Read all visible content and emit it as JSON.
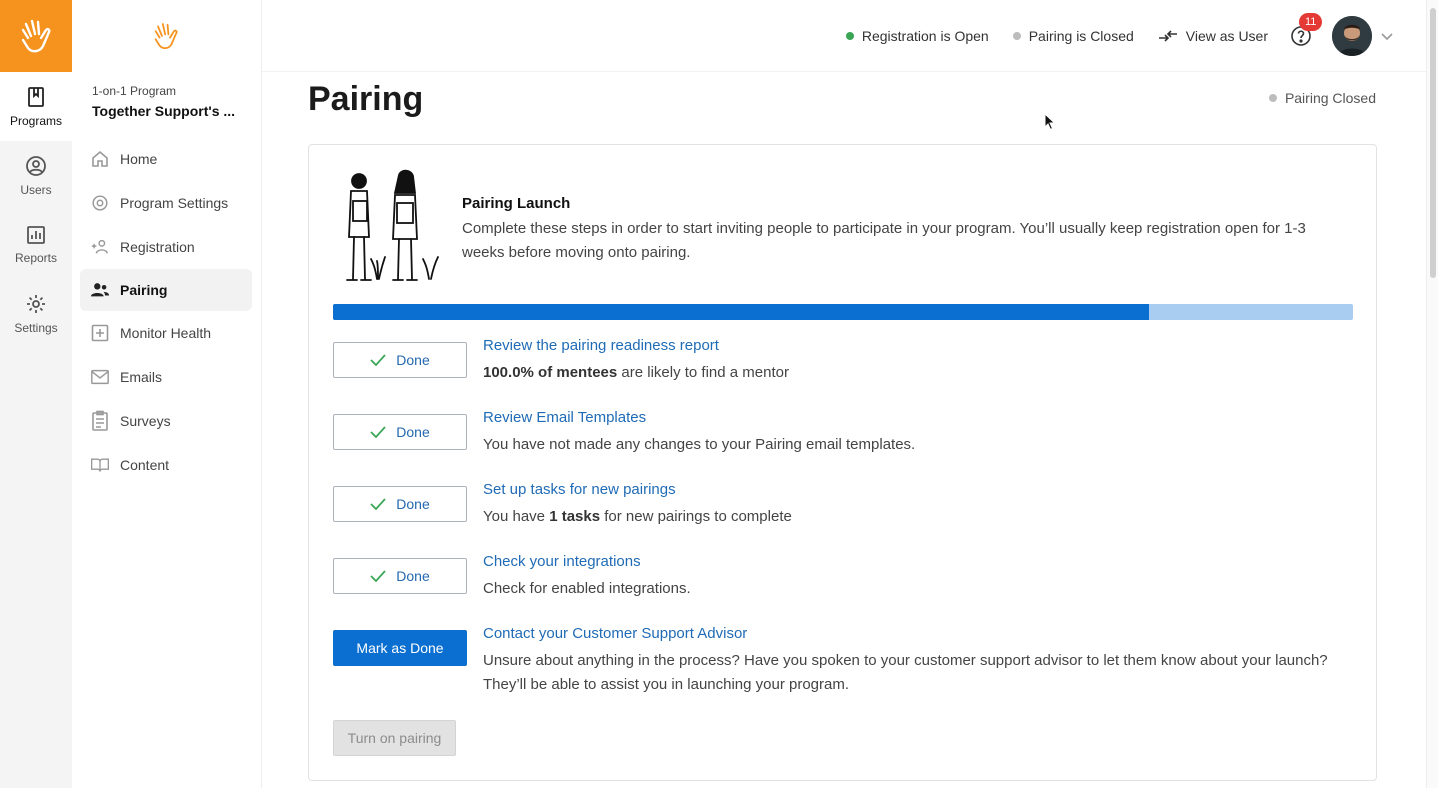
{
  "rail": {
    "items": [
      {
        "label": "Programs",
        "icon": "book-icon",
        "active": true
      },
      {
        "label": "Users",
        "icon": "user-circle-icon"
      },
      {
        "label": "Reports",
        "icon": "bar-chart-icon"
      },
      {
        "label": "Settings",
        "icon": "gear-icon"
      }
    ],
    "brand_color": "#f5931e"
  },
  "sidebar": {
    "program_kind": "1-on-1 Program",
    "program_name": "Together Support's ...",
    "items": [
      {
        "label": "Home",
        "icon": "home-icon"
      },
      {
        "label": "Program Settings",
        "icon": "gear-icon"
      },
      {
        "label": "Registration",
        "icon": "add-user-icon"
      },
      {
        "label": "Pairing",
        "icon": "users-icon",
        "active": true
      },
      {
        "label": "Monitor Health",
        "icon": "plus-box-icon"
      },
      {
        "label": "Emails",
        "icon": "mail-icon"
      },
      {
        "label": "Surveys",
        "icon": "clipboard-icon"
      },
      {
        "label": "Content",
        "icon": "open-book-icon"
      }
    ]
  },
  "header": {
    "registration_status": "Registration is Open",
    "registration_color": "#3aa655",
    "pairing_status": "Pairing is Closed",
    "pairing_color": "#bdbdbd",
    "view_as_user": "View as User",
    "notifications": "11"
  },
  "main": {
    "title": "Pairing",
    "status": "Pairing Closed",
    "launch": {
      "title": "Pairing Launch",
      "description": "Complete these steps in order to start inviting people to participate in your program. You’ll usually keep registration open for 1-3 weeks before moving onto pairing.",
      "progress": 0.8
    },
    "steps": [
      {
        "button": "Done",
        "title": "Review the pairing readiness report",
        "desc_bold": "100.0% of mentees",
        "desc_rest": " are likely to find a mentor"
      },
      {
        "button": "Done",
        "title": "Review Email Templates",
        "desc_pre": "You have not made any changes to your Pairing email templates."
      },
      {
        "button": "Done",
        "title": "Set up tasks for new pairings",
        "desc_pre": "You have ",
        "desc_bold": "1 tasks",
        "desc_rest": " for new pairings to complete"
      },
      {
        "button": "Done",
        "title": "Check your integrations",
        "desc_pre": "Check for enabled integrations."
      },
      {
        "button": "Mark as Done",
        "title": "Contact your Customer Support Advisor",
        "desc_pre": "Unsure about anything in the process? Have you spoken to your customer support advisor to let them know about your launch? They’ll be able to assist you in launching your program."
      }
    ],
    "turn_on": "Turn on pairing"
  }
}
